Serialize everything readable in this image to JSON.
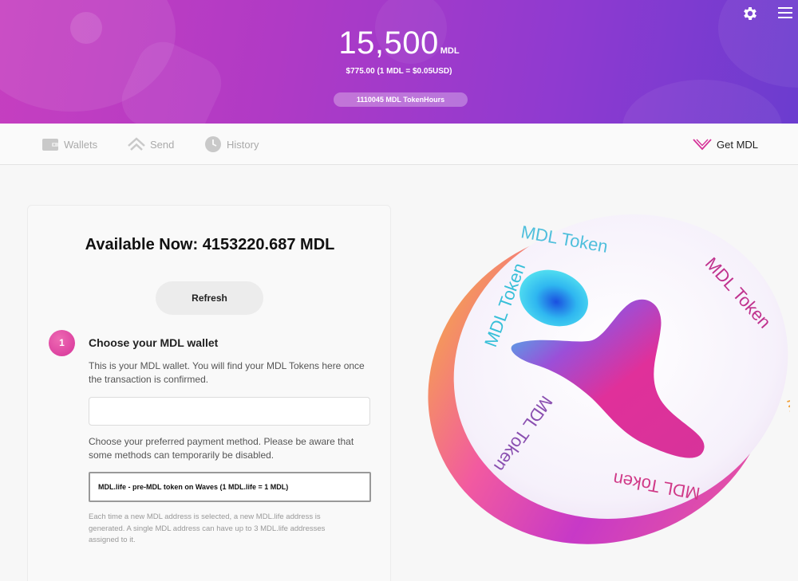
{
  "header": {
    "balance_amount": "15,500",
    "balance_unit": "MDL",
    "usd_line": "$775.00 (1 MDL = $0.05USD)",
    "token_hours": "1110045 MDL TokenHours"
  },
  "nav": {
    "wallets": "Wallets",
    "send": "Send",
    "history": "History",
    "get_mdl": "Get MDL"
  },
  "card": {
    "available": "Available Now: 4153220.687 MDL",
    "refresh": "Refresh",
    "step_number": "1",
    "step_title": "Choose your MDL wallet",
    "step_desc": "This is your MDL wallet. You will find your MDL Tokens here once the transaction is confirmed.",
    "wallet_value": "",
    "payment_desc": "Choose your preferred payment method. Please be aware that some methods can temporarily be disabled.",
    "payment_selected": "MDL.life - pre-MDL token on Waves (1 MDL.life = 1 MDL)",
    "note": "Each time a new MDL address is selected, a new MDL.life address is generated. A single MDL address can have up to 3 MDL.life addresses assigned to it."
  },
  "coin": {
    "label": "MDL Token"
  },
  "colors": {
    "header_start": "#c63fc0",
    "header_end": "#6b3ccf",
    "accent_pink": "#d63399"
  },
  "icons": {
    "settings": "gear-icon",
    "menu": "hamburger-menu-icon",
    "wallets": "wallet-icon",
    "send": "send-chevron-icon",
    "history": "clock-icon",
    "get_mdl": "get-mdl-chevron-icon"
  }
}
